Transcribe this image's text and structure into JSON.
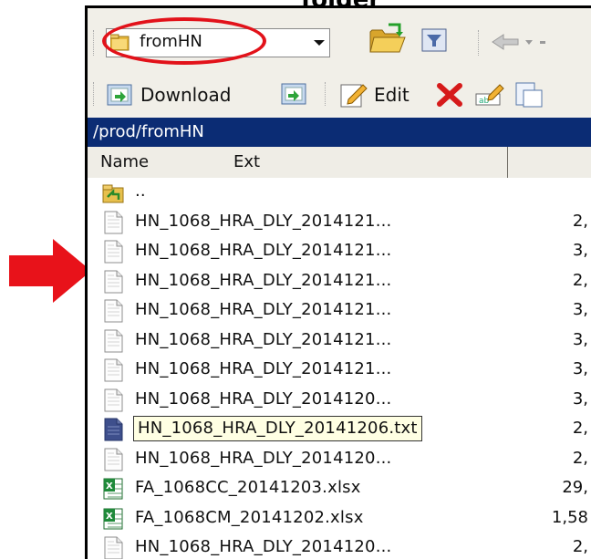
{
  "caption": "folder",
  "toolbar": {
    "folder_combo_value": "fromHN"
  },
  "actions": {
    "download_label": "Download",
    "edit_label": "Edit"
  },
  "path": "/prod/fromHN",
  "columns": {
    "name": "Name",
    "ext": "Ext"
  },
  "files": [
    {
      "name": "..",
      "size": "",
      "icon": "parent-folder-icon"
    },
    {
      "name": "HN_1068_HRA_DLY_2014121...",
      "size": "2,",
      "icon": "text-file-icon"
    },
    {
      "name": "HN_1068_HRA_DLY_2014121...",
      "size": "3,",
      "icon": "text-file-icon"
    },
    {
      "name": "HN_1068_HRA_DLY_2014121...",
      "size": "2,",
      "icon": "text-file-icon"
    },
    {
      "name": "HN_1068_HRA_DLY_2014121...",
      "size": "3,",
      "icon": "text-file-icon"
    },
    {
      "name": "HN_1068_HRA_DLY_2014121...",
      "size": "3,",
      "icon": "text-file-icon"
    },
    {
      "name": "HN_1068_HRA_DLY_2014121...",
      "size": "3,",
      "icon": "text-file-icon"
    },
    {
      "name": "HN_1068_HRA_DLY_2014120...",
      "size": "3,",
      "icon": "text-file-icon"
    },
    {
      "name": "HN_1068_HRA_DLY_20141206.txt",
      "size": "2,",
      "icon": "text-file-icon",
      "selected": true
    },
    {
      "name": "HN_1068_HRA_DLY_2014120...",
      "size": "2,",
      "icon": "text-file-icon"
    },
    {
      "name": "FA_1068CC_20141203.xlsx",
      "size": "29,",
      "icon": "excel-file-icon"
    },
    {
      "name": "FA_1068CM_20141202.xlsx",
      "size": "1,58",
      "icon": "excel-file-icon"
    },
    {
      "name": "HN_1068_HRA_DLY_2014120...",
      "size": "2,",
      "icon": "text-file-icon"
    }
  ],
  "colors": {
    "highlight_red": "#e2121a",
    "path_bar": "#0b2c74",
    "selection_bg": "#ffffe3"
  }
}
